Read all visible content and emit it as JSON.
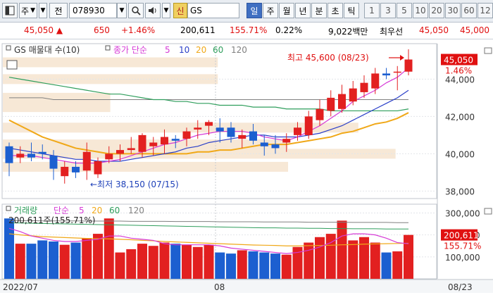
{
  "toolbar": {
    "market_label": "주",
    "prev_label": "전",
    "code": "078930",
    "credit_label": "신",
    "name": "GS",
    "periods": [
      "일",
      "주",
      "월",
      "년",
      "분",
      "초",
      "틱"
    ],
    "selected_period": "일",
    "minute_buttons": [
      "1",
      "3",
      "5",
      "10",
      "20",
      "30",
      "60",
      "12"
    ]
  },
  "quote": {
    "price": "45,050",
    "change": "650",
    "change_rate": "+1.46%",
    "volume": "200,611",
    "volume_ratio": "155.71%",
    "turnover": "0.22%",
    "trading_value": "9,022백만",
    "best_ask_label": "최우선",
    "best_price": "45,050",
    "best_price2": "45,000"
  },
  "colors": {
    "up": "#e22020",
    "down": "#1c5fd0",
    "ma5": "#d63ad6",
    "ma10": "#2a3fc8",
    "ma20": "#f0a818",
    "ma60": "#2f9e5c",
    "ma120": "#808080"
  },
  "price_panel": {
    "legend": {
      "title": "GS 매물대 수(10)",
      "ma_label": "종가 단순",
      "ma_periods": [
        "5",
        "10",
        "20",
        "60",
        "120"
      ]
    },
    "current_price_label": "45,050",
    "current_rate_label": "1.46%",
    "high_annotation": "최고 45,600 (08/23)",
    "low_annotation": "←최저 38,150 (07/15)",
    "y_ticks": [
      "44,000",
      "42,000",
      "40,000",
      "38,000"
    ]
  },
  "volume_panel": {
    "legend": {
      "title": "거래량",
      "ma_label": "단순",
      "ma_periods": [
        "5",
        "20",
        "60",
        "120"
      ]
    },
    "current_volume_annotation": "200,611주(155.71%)",
    "current_volume_label": "200,611",
    "current_rate_label": "155.71%",
    "y_ticks": [
      "300,000",
      "200,000",
      "100,000"
    ]
  },
  "x_axis": {
    "labels": [
      "2022/07",
      "08",
      "08/23"
    ]
  },
  "chart_data": {
    "type": "candlestick",
    "candles": [
      {
        "o": 40.4,
        "h": 40.6,
        "l": 38.8,
        "c": 39.5
      },
      {
        "o": 39.8,
        "h": 40.4,
        "l": 39.5,
        "c": 40.0
      },
      {
        "o": 40.0,
        "h": 40.6,
        "l": 39.6,
        "c": 39.8
      },
      {
        "o": 40.1,
        "h": 40.5,
        "l": 39.7,
        "c": 40.0
      },
      {
        "o": 39.9,
        "h": 40.2,
        "l": 38.6,
        "c": 39.2
      },
      {
        "o": 38.8,
        "h": 39.6,
        "l": 38.4,
        "c": 39.3
      },
      {
        "o": 39.3,
        "h": 39.6,
        "l": 38.7,
        "c": 39.0
      },
      {
        "o": 39.1,
        "h": 40.6,
        "l": 38.6,
        "c": 40.1
      },
      {
        "o": 38.9,
        "h": 39.8,
        "l": 38.7,
        "c": 39.6
      },
      {
        "o": 39.7,
        "h": 40.4,
        "l": 39.5,
        "c": 40.0
      },
      {
        "o": 40.0,
        "h": 40.5,
        "l": 39.6,
        "c": 40.2
      },
      {
        "o": 40.2,
        "h": 40.9,
        "l": 40.0,
        "c": 40.3
      },
      {
        "o": 40.1,
        "h": 41.1,
        "l": 39.8,
        "c": 41.0
      },
      {
        "o": 40.4,
        "h": 40.9,
        "l": 39.9,
        "c": 40.6
      },
      {
        "o": 40.5,
        "h": 41.3,
        "l": 40.0,
        "c": 40.9
      },
      {
        "o": 40.8,
        "h": 41.0,
        "l": 40.3,
        "c": 40.7
      },
      {
        "o": 40.8,
        "h": 41.4,
        "l": 40.4,
        "c": 41.2
      },
      {
        "o": 41.3,
        "h": 41.8,
        "l": 40.8,
        "c": 41.4
      },
      {
        "o": 41.5,
        "h": 41.8,
        "l": 41.0,
        "c": 41.7
      },
      {
        "o": 41.4,
        "h": 41.9,
        "l": 40.6,
        "c": 41.2
      },
      {
        "o": 41.4,
        "h": 41.7,
        "l": 40.6,
        "c": 40.9
      },
      {
        "o": 40.8,
        "h": 41.3,
        "l": 40.3,
        "c": 41.0
      },
      {
        "o": 41.2,
        "h": 41.6,
        "l": 40.5,
        "c": 40.7
      },
      {
        "o": 40.6,
        "h": 41.0,
        "l": 39.9,
        "c": 40.4
      },
      {
        "o": 40.5,
        "h": 41.0,
        "l": 40.0,
        "c": 40.3
      },
      {
        "o": 40.6,
        "h": 41.1,
        "l": 40.1,
        "c": 40.8
      },
      {
        "o": 41.0,
        "h": 41.7,
        "l": 40.7,
        "c": 41.4
      },
      {
        "o": 41.0,
        "h": 42.3,
        "l": 40.8,
        "c": 42.0
      },
      {
        "o": 41.8,
        "h": 42.9,
        "l": 41.5,
        "c": 42.4
      },
      {
        "o": 42.3,
        "h": 43.4,
        "l": 42.0,
        "c": 43.0
      },
      {
        "o": 42.4,
        "h": 43.7,
        "l": 42.2,
        "c": 43.2
      },
      {
        "o": 42.8,
        "h": 43.9,
        "l": 42.6,
        "c": 43.5
      },
      {
        "o": 43.3,
        "h": 44.2,
        "l": 43.0,
        "c": 43.8
      },
      {
        "o": 43.5,
        "h": 44.6,
        "l": 43.2,
        "c": 44.3
      },
      {
        "o": 44.3,
        "h": 44.6,
        "l": 44.0,
        "c": 44.2
      },
      {
        "o": 44.4,
        "h": 44.7,
        "l": 43.4,
        "c": 44.4
      },
      {
        "o": 44.4,
        "h": 45.6,
        "l": 44.2,
        "c": 45.05
      }
    ],
    "volumes": [
      275,
      160,
      160,
      175,
      170,
      155,
      165,
      185,
      205,
      275,
      120,
      135,
      160,
      150,
      165,
      160,
      155,
      145,
      155,
      120,
      115,
      130,
      125,
      120,
      115,
      110,
      145,
      165,
      190,
      205,
      265,
      175,
      190,
      165,
      120,
      125,
      200
    ],
    "ma5": [
      39.9,
      39.9,
      39.9,
      39.8,
      39.7,
      39.6,
      39.5,
      39.5,
      39.5,
      39.6,
      39.7,
      39.9,
      40.1,
      40.3,
      40.5,
      40.6,
      40.8,
      41.0,
      41.1,
      41.2,
      41.2,
      41.2,
      41.1,
      40.9,
      40.8,
      40.7,
      40.9,
      41.2,
      41.5,
      41.9,
      42.3,
      42.8,
      43.1,
      43.4,
      43.8,
      44.1,
      44.6
    ],
    "ma10": [
      40.3,
      40.2,
      40.1,
      40.0,
      39.9,
      39.8,
      39.7,
      39.7,
      39.6,
      39.6,
      39.6,
      39.7,
      39.8,
      39.9,
      40.0,
      40.1,
      40.3,
      40.4,
      40.6,
      40.7,
      40.8,
      40.9,
      41.0,
      41.0,
      40.9,
      40.9,
      40.9,
      41.0,
      41.1,
      41.3,
      41.5,
      41.8,
      42.1,
      42.4,
      42.7,
      43.0,
      43.4
    ],
    "ma20": [
      41.8,
      41.5,
      41.2,
      40.9,
      40.7,
      40.5,
      40.3,
      40.2,
      40.1,
      40.0,
      40.0,
      40.0,
      40.0,
      40.0,
      40.0,
      40.0,
      40.0,
      40.1,
      40.1,
      40.2,
      40.2,
      40.3,
      40.4,
      40.5,
      40.5,
      40.5,
      40.6,
      40.7,
      40.8,
      40.9,
      41.1,
      41.2,
      41.4,
      41.6,
      41.7,
      41.9,
      42.2
    ],
    "ma60": [
      44.1,
      44.0,
      43.9,
      43.8,
      43.7,
      43.6,
      43.5,
      43.4,
      43.3,
      43.2,
      43.2,
      43.1,
      43.0,
      42.9,
      42.9,
      42.8,
      42.8,
      42.7,
      42.7,
      42.6,
      42.6,
      42.6,
      42.5,
      42.5,
      42.5,
      42.4,
      42.4,
      42.4,
      42.4,
      42.3,
      42.3,
      42.3,
      42.3,
      42.3,
      42.3,
      42.3,
      42.4
    ],
    "ma120": [
      43.0,
      43.0,
      43.0,
      43.0,
      42.9,
      42.9,
      42.9,
      42.9,
      42.9,
      42.9,
      42.9,
      42.9,
      42.9,
      42.9,
      42.9,
      42.9,
      42.9,
      42.9,
      42.9,
      42.9,
      42.9,
      42.9,
      42.9,
      42.9,
      42.9,
      42.9,
      42.9,
      42.9,
      42.9,
      42.9,
      42.9,
      42.9,
      42.9,
      42.9,
      42.9,
      42.9,
      42.9
    ],
    "vol_ma5": [
      230,
      215,
      195,
      185,
      175,
      170,
      170,
      175,
      180,
      195,
      195,
      185,
      180,
      175,
      160,
      155,
      155,
      155,
      155,
      150,
      140,
      135,
      130,
      125,
      120,
      115,
      120,
      130,
      145,
      165,
      195,
      205,
      205,
      200,
      185,
      165,
      160
    ],
    "vol_ma20": [
      205,
      200,
      196,
      192,
      190,
      188,
      186,
      184,
      183,
      182,
      180,
      178,
      175,
      173,
      170,
      168,
      166,
      164,
      162,
      160,
      158,
      156,
      154,
      153,
      152,
      150,
      150,
      151,
      152,
      153,
      155,
      156,
      158,
      159,
      160,
      161,
      162
    ],
    "vol_ma60": [
      255,
      254,
      253,
      252,
      251,
      250,
      249,
      248,
      247,
      246,
      245,
      244,
      243,
      242,
      241,
      240,
      239,
      238,
      237,
      236,
      235,
      234,
      233,
      232,
      232,
      231,
      231,
      230,
      230,
      229,
      229,
      228,
      228,
      228,
      227,
      227,
      227
    ],
    "vol_ma120": [
      265,
      265,
      265,
      264,
      264,
      264,
      264,
      263,
      263,
      263,
      263,
      262,
      262,
      262,
      262,
      261,
      261,
      261,
      261,
      260,
      260,
      260,
      260,
      259,
      259,
      259,
      259,
      258,
      258,
      258,
      258,
      257,
      257,
      257,
      257,
      256,
      256
    ],
    "price_range": [
      37.6,
      45.9
    ],
    "volume_range": [
      0,
      340
    ],
    "volume_profile": [
      0.52,
      0.52,
      0.26,
      0.26,
      0.86,
      0.69,
      0.95,
      0.69,
      0.0
    ]
  }
}
